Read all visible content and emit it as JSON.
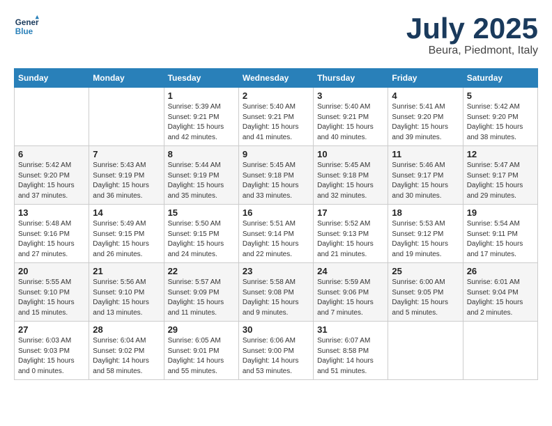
{
  "header": {
    "logo_line1": "General",
    "logo_line2": "Blue",
    "month_year": "July 2025",
    "location": "Beura, Piedmont, Italy"
  },
  "weekdays": [
    "Sunday",
    "Monday",
    "Tuesday",
    "Wednesday",
    "Thursday",
    "Friday",
    "Saturday"
  ],
  "weeks": [
    [
      {
        "day": "",
        "info": ""
      },
      {
        "day": "",
        "info": ""
      },
      {
        "day": "1",
        "info": "Sunrise: 5:39 AM\nSunset: 9:21 PM\nDaylight: 15 hours and 42 minutes."
      },
      {
        "day": "2",
        "info": "Sunrise: 5:40 AM\nSunset: 9:21 PM\nDaylight: 15 hours and 41 minutes."
      },
      {
        "day": "3",
        "info": "Sunrise: 5:40 AM\nSunset: 9:21 PM\nDaylight: 15 hours and 40 minutes."
      },
      {
        "day": "4",
        "info": "Sunrise: 5:41 AM\nSunset: 9:20 PM\nDaylight: 15 hours and 39 minutes."
      },
      {
        "day": "5",
        "info": "Sunrise: 5:42 AM\nSunset: 9:20 PM\nDaylight: 15 hours and 38 minutes."
      }
    ],
    [
      {
        "day": "6",
        "info": "Sunrise: 5:42 AM\nSunset: 9:20 PM\nDaylight: 15 hours and 37 minutes."
      },
      {
        "day": "7",
        "info": "Sunrise: 5:43 AM\nSunset: 9:19 PM\nDaylight: 15 hours and 36 minutes."
      },
      {
        "day": "8",
        "info": "Sunrise: 5:44 AM\nSunset: 9:19 PM\nDaylight: 15 hours and 35 minutes."
      },
      {
        "day": "9",
        "info": "Sunrise: 5:45 AM\nSunset: 9:18 PM\nDaylight: 15 hours and 33 minutes."
      },
      {
        "day": "10",
        "info": "Sunrise: 5:45 AM\nSunset: 9:18 PM\nDaylight: 15 hours and 32 minutes."
      },
      {
        "day": "11",
        "info": "Sunrise: 5:46 AM\nSunset: 9:17 PM\nDaylight: 15 hours and 30 minutes."
      },
      {
        "day": "12",
        "info": "Sunrise: 5:47 AM\nSunset: 9:17 PM\nDaylight: 15 hours and 29 minutes."
      }
    ],
    [
      {
        "day": "13",
        "info": "Sunrise: 5:48 AM\nSunset: 9:16 PM\nDaylight: 15 hours and 27 minutes."
      },
      {
        "day": "14",
        "info": "Sunrise: 5:49 AM\nSunset: 9:15 PM\nDaylight: 15 hours and 26 minutes."
      },
      {
        "day": "15",
        "info": "Sunrise: 5:50 AM\nSunset: 9:15 PM\nDaylight: 15 hours and 24 minutes."
      },
      {
        "day": "16",
        "info": "Sunrise: 5:51 AM\nSunset: 9:14 PM\nDaylight: 15 hours and 22 minutes."
      },
      {
        "day": "17",
        "info": "Sunrise: 5:52 AM\nSunset: 9:13 PM\nDaylight: 15 hours and 21 minutes."
      },
      {
        "day": "18",
        "info": "Sunrise: 5:53 AM\nSunset: 9:12 PM\nDaylight: 15 hours and 19 minutes."
      },
      {
        "day": "19",
        "info": "Sunrise: 5:54 AM\nSunset: 9:11 PM\nDaylight: 15 hours and 17 minutes."
      }
    ],
    [
      {
        "day": "20",
        "info": "Sunrise: 5:55 AM\nSunset: 9:10 PM\nDaylight: 15 hours and 15 minutes."
      },
      {
        "day": "21",
        "info": "Sunrise: 5:56 AM\nSunset: 9:10 PM\nDaylight: 15 hours and 13 minutes."
      },
      {
        "day": "22",
        "info": "Sunrise: 5:57 AM\nSunset: 9:09 PM\nDaylight: 15 hours and 11 minutes."
      },
      {
        "day": "23",
        "info": "Sunrise: 5:58 AM\nSunset: 9:08 PM\nDaylight: 15 hours and 9 minutes."
      },
      {
        "day": "24",
        "info": "Sunrise: 5:59 AM\nSunset: 9:06 PM\nDaylight: 15 hours and 7 minutes."
      },
      {
        "day": "25",
        "info": "Sunrise: 6:00 AM\nSunset: 9:05 PM\nDaylight: 15 hours and 5 minutes."
      },
      {
        "day": "26",
        "info": "Sunrise: 6:01 AM\nSunset: 9:04 PM\nDaylight: 15 hours and 2 minutes."
      }
    ],
    [
      {
        "day": "27",
        "info": "Sunrise: 6:03 AM\nSunset: 9:03 PM\nDaylight: 15 hours and 0 minutes."
      },
      {
        "day": "28",
        "info": "Sunrise: 6:04 AM\nSunset: 9:02 PM\nDaylight: 14 hours and 58 minutes."
      },
      {
        "day": "29",
        "info": "Sunrise: 6:05 AM\nSunset: 9:01 PM\nDaylight: 14 hours and 55 minutes."
      },
      {
        "day": "30",
        "info": "Sunrise: 6:06 AM\nSunset: 9:00 PM\nDaylight: 14 hours and 53 minutes."
      },
      {
        "day": "31",
        "info": "Sunrise: 6:07 AM\nSunset: 8:58 PM\nDaylight: 14 hours and 51 minutes."
      },
      {
        "day": "",
        "info": ""
      },
      {
        "day": "",
        "info": ""
      }
    ]
  ]
}
